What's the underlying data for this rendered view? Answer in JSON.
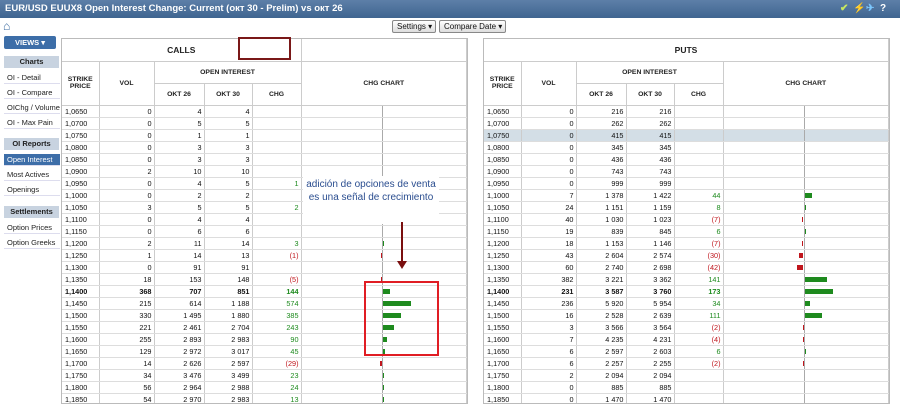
{
  "title": "EUR/USD EUUX8 Open Interest Change: Current (окт 30 - Prelim) vs окт 26",
  "title_icons": [
    "check-icon",
    "bolt-icon",
    "twitter-icon",
    "help-icon"
  ],
  "toolbar": {
    "settings": "Settings",
    "compare": "Compare Date"
  },
  "sidebar": {
    "views": "VIEWS",
    "charts_header": "Charts",
    "charts": [
      "OI - Detail",
      "OI - Compare",
      "OIChg / Volume",
      "OI - Max Pain"
    ],
    "reports_header": "OI Reports",
    "reports": [
      "Open Interest",
      "Most Actives",
      "Openings"
    ],
    "settlements_header": "Settlements",
    "settlements": [
      "Option Prices",
      "Option Greeks"
    ]
  },
  "calls": {
    "title": "CALLS",
    "headers": {
      "strike": "STRIKE PRICE",
      "vol": "VOL",
      "oi": "OPEN INTEREST",
      "okt26": "OKT 26",
      "okt30": "OKT 30",
      "chg": "CHG",
      "chart": "CHG CHART"
    },
    "rows": [
      [
        "1,0650",
        "0",
        "4",
        "4",
        ""
      ],
      [
        "1,0700",
        "0",
        "5",
        "5",
        ""
      ],
      [
        "1,0750",
        "0",
        "1",
        "1",
        ""
      ],
      [
        "1,0800",
        "0",
        "3",
        "3",
        ""
      ],
      [
        "1,0850",
        "0",
        "3",
        "3",
        ""
      ],
      [
        "1,0900",
        "2",
        "10",
        "10",
        ""
      ],
      [
        "1,0950",
        "0",
        "4",
        "5",
        "1"
      ],
      [
        "1,1000",
        "0",
        "2",
        "2",
        ""
      ],
      [
        "1,1050",
        "3",
        "5",
        "5",
        "2"
      ],
      [
        "1,1100",
        "0",
        "4",
        "4",
        ""
      ],
      [
        "1,1150",
        "0",
        "6",
        "6",
        ""
      ],
      [
        "1,1200",
        "2",
        "11",
        "14",
        "3"
      ],
      [
        "1,1250",
        "1",
        "14",
        "13",
        "(1)"
      ],
      [
        "1,1300",
        "0",
        "91",
        "91",
        ""
      ],
      [
        "1,1350",
        "18",
        "153",
        "148",
        "(5)"
      ],
      [
        "1,1400",
        "368",
        "707",
        "851",
        "144"
      ],
      [
        "1,1450",
        "215",
        "614",
        "1 188",
        "574"
      ],
      [
        "1,1500",
        "330",
        "1 495",
        "1 880",
        "385"
      ],
      [
        "1,1550",
        "221",
        "2 461",
        "2 704",
        "243"
      ],
      [
        "1,1600",
        "255",
        "2 893",
        "2 983",
        "90"
      ],
      [
        "1,1650",
        "129",
        "2 972",
        "3 017",
        "45"
      ],
      [
        "1,1700",
        "14",
        "2 626",
        "2 597",
        "(29)"
      ],
      [
        "1,1750",
        "34",
        "3 476",
        "3 499",
        "23"
      ],
      [
        "1,1800",
        "56",
        "2 964",
        "2 988",
        "24"
      ],
      [
        "1,1850",
        "54",
        "2 970",
        "2 983",
        "13"
      ]
    ]
  },
  "puts": {
    "title": "PUTS",
    "headers": {
      "strike": "STRIKE PRICE",
      "vol": "VOL",
      "oi": "OPEN INTEREST",
      "okt26": "OKT 26",
      "okt30": "OKT 30",
      "chg": "CHG",
      "chart": "CHG CHART"
    },
    "rows": [
      [
        "1,0650",
        "0",
        "216",
        "216",
        ""
      ],
      [
        "1,0700",
        "0",
        "262",
        "262",
        ""
      ],
      [
        "1,0750",
        "0",
        "415",
        "415",
        ""
      ],
      [
        "1,0800",
        "0",
        "345",
        "345",
        ""
      ],
      [
        "1,0850",
        "0",
        "436",
        "436",
        ""
      ],
      [
        "1,0900",
        "0",
        "743",
        "743",
        ""
      ],
      [
        "1,0950",
        "0",
        "999",
        "999",
        ""
      ],
      [
        "1,1000",
        "7",
        "1 378",
        "1 422",
        "44"
      ],
      [
        "1,1050",
        "24",
        "1 151",
        "1 159",
        "8"
      ],
      [
        "1,1100",
        "40",
        "1 030",
        "1 023",
        "(7)"
      ],
      [
        "1,1150",
        "19",
        "839",
        "845",
        "6"
      ],
      [
        "1,1200",
        "18",
        "1 153",
        "1 146",
        "(7)"
      ],
      [
        "1,1250",
        "43",
        "2 604",
        "2 574",
        "(30)"
      ],
      [
        "1,1300",
        "60",
        "2 740",
        "2 698",
        "(42)"
      ],
      [
        "1,1350",
        "382",
        "3 221",
        "3 362",
        "141"
      ],
      [
        "1,1400",
        "231",
        "3 587",
        "3 760",
        "173"
      ],
      [
        "1,1450",
        "236",
        "5 920",
        "5 954",
        "34"
      ],
      [
        "1,1500",
        "16",
        "2 528",
        "2 639",
        "111"
      ],
      [
        "1,1550",
        "3",
        "3 566",
        "3 564",
        "(2)"
      ],
      [
        "1,1600",
        "7",
        "4 235",
        "4 231",
        "(4)"
      ],
      [
        "1,1650",
        "6",
        "2 597",
        "2 603",
        "6"
      ],
      [
        "1,1700",
        "6",
        "2 257",
        "2 255",
        "(2)"
      ],
      [
        "1,1750",
        "2",
        "2 094",
        "2 094",
        ""
      ],
      [
        "1,1800",
        "0",
        "885",
        "885",
        ""
      ],
      [
        "1,1850",
        "0",
        "1 470",
        "1 470",
        ""
      ]
    ]
  },
  "highlight_strike": "1,1400",
  "hover_row_puts": "1,0750",
  "annotation": "adición de opciones de venta es una señal de crecimiento",
  "colors": {
    "positive": "#1e8a1e",
    "negative": "#c0161d",
    "header_blue": "#3d6ea8",
    "annotation_box": "#e01d24"
  }
}
